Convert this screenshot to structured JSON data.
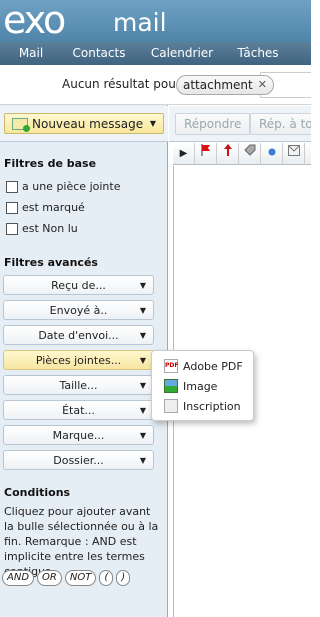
{
  "brand": {
    "exo": "exo",
    "mail": "mail"
  },
  "nav": [
    "Mail",
    "Contacts",
    "Calendrier",
    "Tâches"
  ],
  "search": {
    "label": "Aucun résultat pour :",
    "chip": "attachment",
    "chip_close": "✕",
    "value": ""
  },
  "toolbar": {
    "new_message": "Nouveau message",
    "reply": "Répondre",
    "reply_all": "Rép. à tou"
  },
  "basic_filters": {
    "title": "Filtres de base",
    "items": [
      "a une pièce jointe",
      "est marqué",
      "est Non lu"
    ]
  },
  "advanced_filters": {
    "title": "Filtres avancés",
    "items": [
      "Reçu de...",
      "Envoyé à..",
      "Date d'envoi...",
      "Pièces jointes...",
      "Taille...",
      "État...",
      "Marque...",
      "Dossier..."
    ]
  },
  "attachments_menu": [
    "Adobe PDF",
    "Image",
    "Inscription"
  ],
  "conditions": {
    "title": "Conditions",
    "text": "Cliquez pour ajouter avant la bulle sélectionnée ou à la fin. Remarque : AND est implicite entre les termes contigus.",
    "ops": [
      "AND",
      "OR",
      "NOT",
      "(",
      ")"
    ]
  },
  "colors": {
    "header": "#5a8db0",
    "nav": "#4d7290",
    "sidebar": "#e6eef5",
    "highlight": "#f7e6a2"
  }
}
